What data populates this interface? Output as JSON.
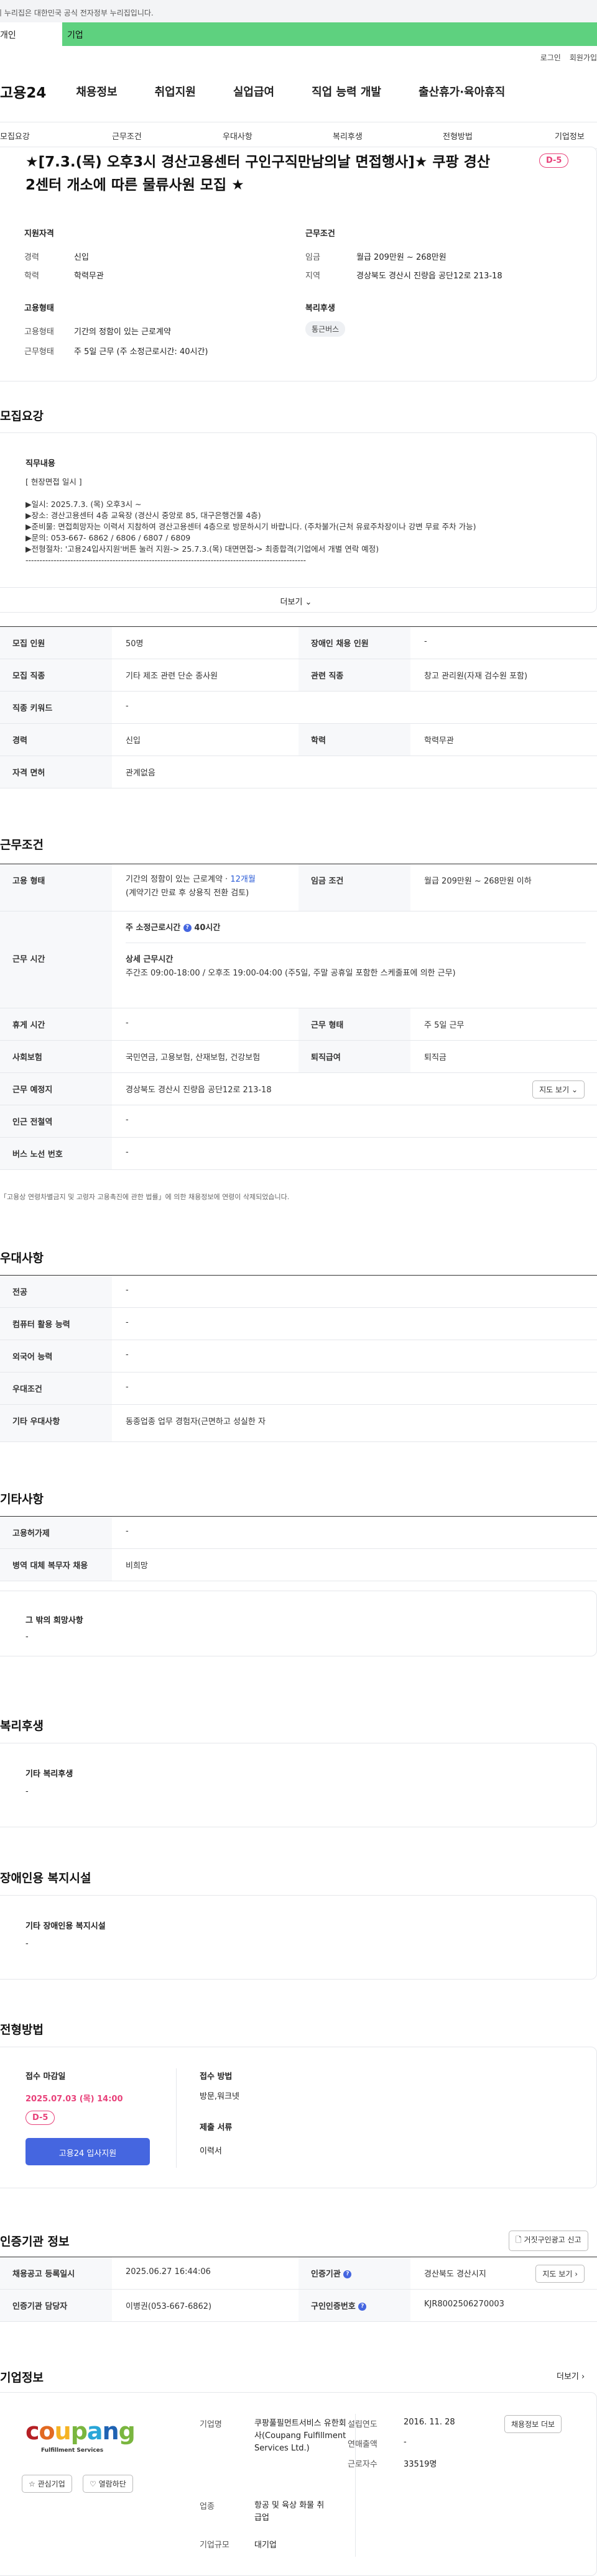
{
  "gov_banner": "이 누리집은 대한민국 공식 전자정부 누리집입니다.",
  "topbar": {
    "left_label": "개인",
    "right_label": "기업"
  },
  "util": {
    "login": "로그인",
    "signup": "회원가입"
  },
  "logo": "고용24",
  "main_nav": [
    "채용정보",
    "취업지원",
    "실업급여",
    "직업 능력 개발",
    "출산휴가·육아휴직"
  ],
  "sub_nav": [
    "모집요강",
    "근무조건",
    "우대사항",
    "복리후생",
    "전형방법",
    "기업정보"
  ],
  "job_title": "★[7.3.(목) 오후3시 경산고용센터 구인구직만남의날 면접행사]★ 쿠팡 경산2센터 개소에 따른 물류사원 모집 ★",
  "d_day": "D-5",
  "summary": {
    "qual_title": "지원자격",
    "career_label": "경력",
    "career_value": "신입",
    "edu_label": "학력",
    "edu_value": "학력무관",
    "cond_title": "근무조건",
    "wage_label": "임금",
    "wage_value": "월급 209만원 ~ 268만원",
    "loc_label": "지역",
    "loc_value": "경상북도 경산시 진량읍 공단12로 213-18",
    "emp_title": "고용형태",
    "emp_label": "고용형태",
    "emp_value": "기간의 정함이 있는 근로계약",
    "hours_label": "근무형태",
    "hours_value": "주 5일 근무 (주 소정근로시간: 40시간)",
    "welfare_title": "복리후생",
    "welfare_tag": "통근버스"
  },
  "recruit": {
    "heading": "모집요강",
    "duty_title": "직무내용",
    "duty_lines": [
      "[ 현장면접 일시 ]",
      "▶일시: 2025.7.3. (목) 오후3시 ~",
      "▶장소: 경산고용센터 4층 교육장 (경산시 중앙로 85, 대구은행건물 4층)",
      "▶준비물: 면접희망자는 이력서 지참하여 경산고용센터 4층으로 방문하시기 바랍니다. (주차불가(근처 유료주차장이나 강변 무료 주차 가능)",
      "▶문의: 053-667- 6862 / 6806 / 6807 / 6809",
      "▶전형절차: '고용24입사지원'버튼 눌러 지원-> 25.7.3.(목) 대면면접-> 최종합격(기업에서 개별 연락 예정)",
      "----------------------------------------------------------------------------------------------------"
    ],
    "more": "더보기",
    "rows": {
      "count_label": "모집 인원",
      "count_value": "50명",
      "disabled_label": "장애인 채용 인원",
      "disabled_value": "-",
      "job_label": "모집 직종",
      "job_value": "기타 제조 관련 단순 종사원",
      "related_label": "관련 직종",
      "related_value": "창고 관리원(자재 검수원 포함)",
      "kw_label": "직종 키워드",
      "kw_value": "-",
      "career_label": "경력",
      "career_value": "신입",
      "edu_label": "학력",
      "edu_value": "학력무관",
      "license_label": "자격 면허",
      "license_value": "관계없음"
    }
  },
  "work": {
    "heading": "근무조건",
    "emp_label": "고용 형태",
    "emp_value": "기간의 정함이 있는 근로계약 · ",
    "emp_months": "12개월",
    "emp_note": "(계약기간 만료 후 상용직 전환 검토)",
    "wage_label": "임금 조건",
    "wage_value": "월급 209만원 ~ 268만원 이하",
    "time_label": "근무 시간",
    "weekly_label": "주 소정근로시간",
    "weekly_value": "40시간",
    "detail_label": "상세 근무시간",
    "detail_value": "주간조 09:00-18:00 / 오후조 19:00-04:00 (주5일, 주말 공휴일 포함한 스케줄표에 의한 근무)",
    "rest_label": "휴게 시간",
    "rest_value": "-",
    "form_label": "근무 형태",
    "form_value": "주 5일 근무",
    "ins_label": "사회보험",
    "ins_value": "국민연금, 고용보험, 산재보험, 건강보험",
    "retire_label": "퇴직급여",
    "retire_value": "퇴직금",
    "place_label": "근무 예정지",
    "place_value": "경상북도 경산시 진량읍 공단12로 213-18",
    "map_btn": "지도 보기",
    "subway_label": "인근 전철역",
    "subway_value": "-",
    "bus_label": "버스 노선 번호",
    "bus_value": "-",
    "note": "「고용상 연령차별금지 및 고령자 고용촉진에 관한 법률」에 의한 채용정보에 연령이 삭제되었습니다."
  },
  "pref": {
    "heading": "우대사항",
    "major_label": "전공",
    "major_value": "-",
    "pc_label": "컴퓨터 활용 능력",
    "pc_value": "-",
    "lang_label": "외국어 능력",
    "lang_value": "-",
    "cond_label": "우대조건",
    "cond_value": "-",
    "etc_label": "기타 우대사항",
    "etc_value": "동종업종 업무 경험자(근면하고 성실한 자"
  },
  "other": {
    "heading": "기타사항",
    "reg_label": "고용허가제",
    "reg_value": "-",
    "mil_label": "병역 대체 복무자 채용",
    "mil_value": "비희망",
    "wish_title": "그 밖의 희망사항",
    "wish_value": "-"
  },
  "welfare": {
    "heading": "복리후생",
    "title": "기타 복리후생",
    "value": "-"
  },
  "facility": {
    "heading": "장애인용 복지시설",
    "title": "기타 장애인용 복지시설",
    "value": "-"
  },
  "process": {
    "heading": "전형방법",
    "deadline_title": "접수 마감일",
    "deadline": "2025.07.03 (목) 14:00",
    "dday": "D-5",
    "apply_btn": "고용24 입사지원",
    "method_title": "접수 방법",
    "method_value": "방문,워크넷",
    "docs_title": "제출 서류",
    "docs_value": "이력서"
  },
  "cert": {
    "heading": "인증기관 정보",
    "report_btn": "거짓구인광고 신고",
    "date_label": "채용공고 등록일시",
    "date_value": "2025.06.27 16:44:06",
    "agency_label": "인증기관",
    "agency_value": "경산북도 경산시지",
    "map_btn": "지도 보기",
    "manager_label": "인증기관 담당자",
    "manager_value": "이병권(053-667-6862)",
    "no_label": "구인인증번호",
    "no_value": "KJR8002506270003"
  },
  "company": {
    "heading": "기업정보",
    "more": "더보기",
    "logo_text": "coupang",
    "logo_sub": "Fulfillment Services",
    "fav_btn": "관심기업",
    "like_btn": "열람하단",
    "name_label": "기업명",
    "name_value": "쿠팡풀필먼트서비스 유한회사(Coupang Fulfillment Services Ltd.)",
    "founded_label": "설립연도",
    "founded_value": "2016. 11. 28",
    "sales_label": "연매출액",
    "sales_value": "-",
    "emp_label": "근로자수",
    "emp_value": "33519명",
    "industry_label": "업종",
    "industry_value": "항공 및 육상 화물 취급업",
    "size_label": "기업규모",
    "size_value": "대기업",
    "jobs_btn": "채용정보 더보"
  }
}
